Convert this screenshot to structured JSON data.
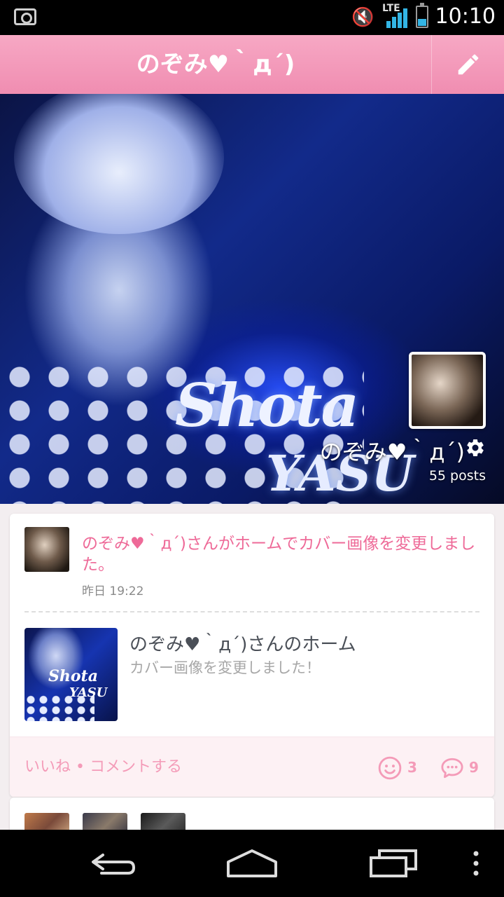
{
  "status_bar": {
    "time": "10:10",
    "network": "LTE"
  },
  "action_bar": {
    "title": "のぞみ♥｀дˊ)"
  },
  "cover": {
    "overlay_text_1": "Shota",
    "overlay_text_2": "YASU",
    "profile_name": "のぞみ♥｀дˊ)",
    "posts_count": "55 posts"
  },
  "feed": {
    "activity": {
      "text": "のぞみ♥｀дˊ)さんがホームでカバー画像を変更しました。",
      "timestamp": "昨日 19:22"
    },
    "post": {
      "thumb_text_1": "Shota",
      "thumb_text_2": "YASU",
      "title": "のぞみ♥｀дˊ)さんのホーム",
      "subtitle": "カバー画像を変更しました！"
    },
    "footer": {
      "like_comment_label": "いいね • コメントする",
      "smile_count": "3",
      "comment_count": "9"
    }
  },
  "colors": {
    "accent_pink": "#f08db1",
    "activity_pink": "#ee6a98",
    "footer_bg": "#fdf1f4",
    "system_blue": "#33b5e5"
  }
}
